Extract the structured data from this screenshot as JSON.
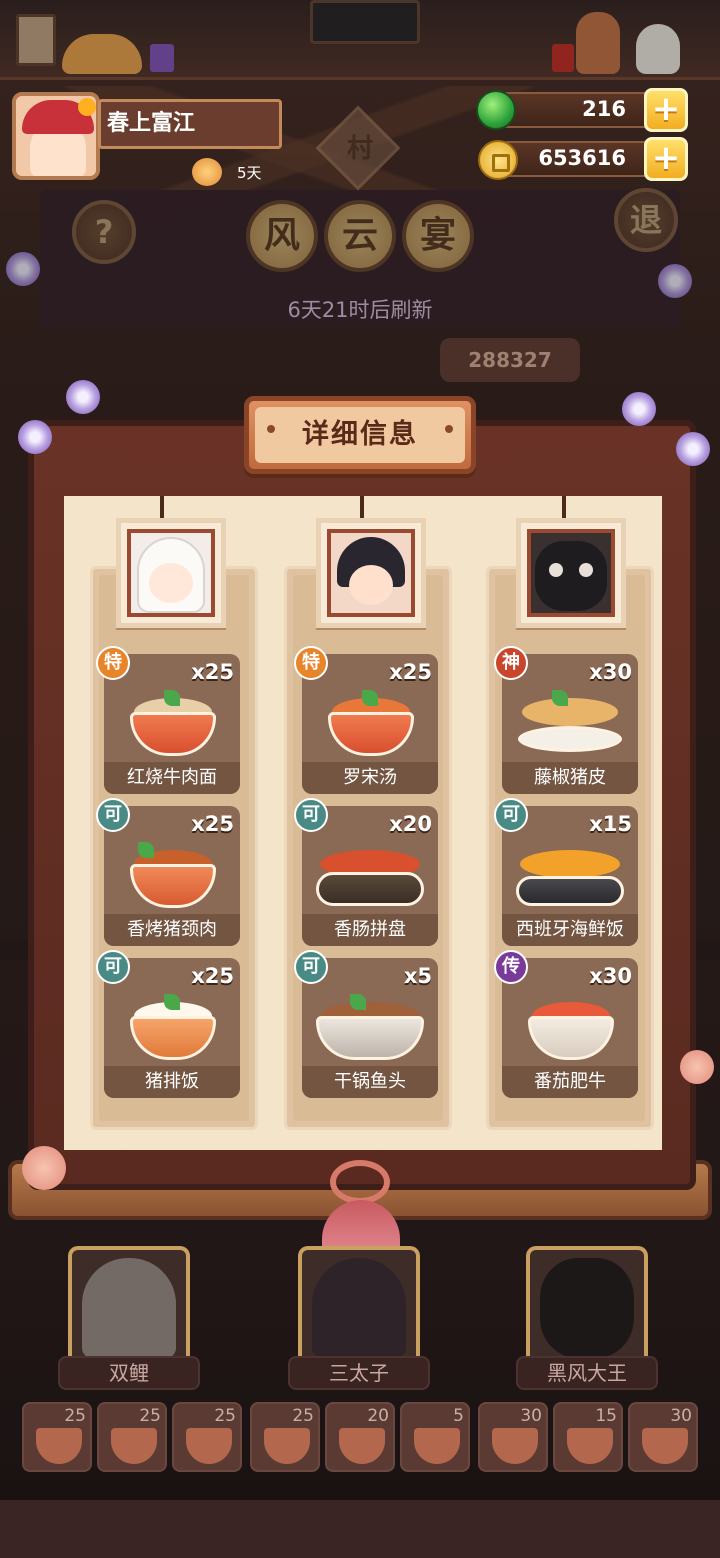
{
  "player": {
    "name": "春上富江",
    "days": "5天"
  },
  "resources": {
    "jade": "216",
    "coins": "653616",
    "plus": "+"
  },
  "top_buttons": {
    "help": "?",
    "exit": "退",
    "village": "村"
  },
  "feast": {
    "chars": [
      "风",
      "云",
      "宴"
    ],
    "refresh": "6天21时后刷新",
    "score": "288327"
  },
  "panel": {
    "title": "详细信息",
    "columns": [
      {
        "dishes": [
          {
            "badge": "特",
            "qty": "x25",
            "name": "红烧牛肉面"
          },
          {
            "badge": "可",
            "qty": "x25",
            "name": "香烤猪颈肉"
          },
          {
            "badge": "可",
            "qty": "x25",
            "name": "猪排饭"
          }
        ]
      },
      {
        "dishes": [
          {
            "badge": "特",
            "qty": "x25",
            "name": "罗宋汤"
          },
          {
            "badge": "可",
            "qty": "x20",
            "name": "香肠拼盘"
          },
          {
            "badge": "可",
            "qty": "x5",
            "name": "干锅鱼头"
          }
        ]
      },
      {
        "dishes": [
          {
            "badge": "神",
            "qty": "x30",
            "name": "藤椒猪皮"
          },
          {
            "badge": "可",
            "qty": "x15",
            "name": "西班牙海鲜饭"
          },
          {
            "badge": "传",
            "qty": "x30",
            "name": "番茄肥牛"
          }
        ]
      }
    ]
  },
  "team": {
    "members": [
      "双鲤",
      "三太子",
      "黑风大王"
    ]
  },
  "slots": [
    "25",
    "25",
    "25",
    "25",
    "20",
    "5",
    "30",
    "15",
    "30"
  ],
  "colors": {
    "badge_te": "#e8842a",
    "badge_ke": "#4a8a84",
    "badge_shen": "#c8462c",
    "badge_chuan": "#7a3a9a",
    "gold": "#f2ad22"
  },
  "icons": {
    "jade": "jade-icon",
    "coin": "coin-icon",
    "plus": "plus-icon",
    "days": "hourglass-icon"
  }
}
